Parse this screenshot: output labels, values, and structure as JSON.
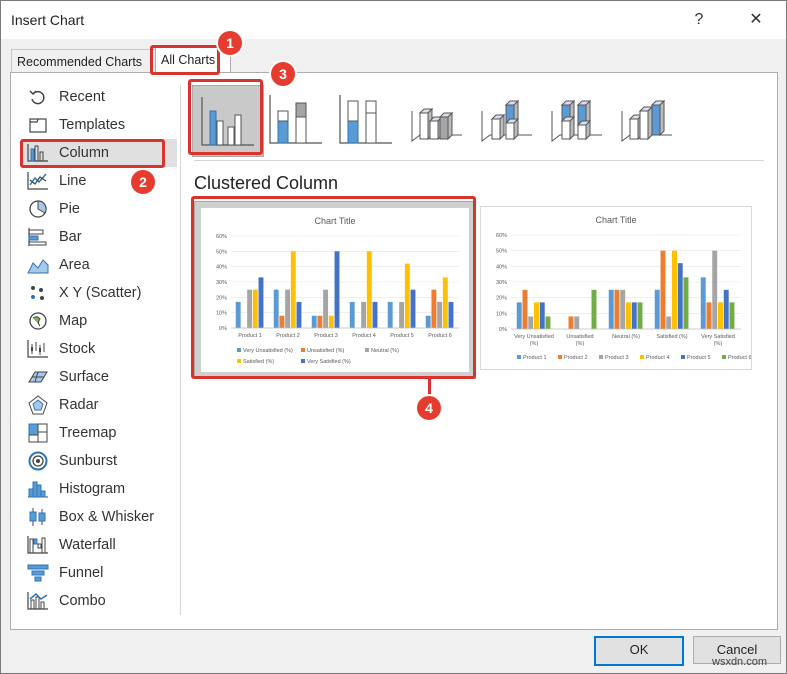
{
  "window": {
    "title": "Insert Chart",
    "help": "?",
    "close": "✕"
  },
  "tabs": [
    {
      "label": "Recommended Charts",
      "active": false
    },
    {
      "label": "All Charts",
      "active": true
    }
  ],
  "chart_types": [
    {
      "label": "Recent",
      "icon": "recent-icon"
    },
    {
      "label": "Templates",
      "icon": "templates-icon"
    },
    {
      "label": "Column",
      "icon": "column-chart-icon",
      "selected": true
    },
    {
      "label": "Line",
      "icon": "line-chart-icon"
    },
    {
      "label": "Pie",
      "icon": "pie-chart-icon"
    },
    {
      "label": "Bar",
      "icon": "bar-chart-icon"
    },
    {
      "label": "Area",
      "icon": "area-chart-icon"
    },
    {
      "label": "X Y (Scatter)",
      "icon": "scatter-chart-icon"
    },
    {
      "label": "Map",
      "icon": "map-chart-icon"
    },
    {
      "label": "Stock",
      "icon": "stock-chart-icon"
    },
    {
      "label": "Surface",
      "icon": "surface-chart-icon"
    },
    {
      "label": "Radar",
      "icon": "radar-chart-icon"
    },
    {
      "label": "Treemap",
      "icon": "treemap-chart-icon"
    },
    {
      "label": "Sunburst",
      "icon": "sunburst-chart-icon"
    },
    {
      "label": "Histogram",
      "icon": "histogram-chart-icon"
    },
    {
      "label": "Box & Whisker",
      "icon": "box-whisker-chart-icon"
    },
    {
      "label": "Waterfall",
      "icon": "waterfall-chart-icon"
    },
    {
      "label": "Funnel",
      "icon": "funnel-chart-icon"
    },
    {
      "label": "Combo",
      "icon": "combo-chart-icon"
    }
  ],
  "subtypes": [
    {
      "icon": "clustered-column-icon",
      "selected": true
    },
    {
      "icon": "stacked-column-icon"
    },
    {
      "icon": "100-stacked-column-icon"
    },
    {
      "icon": "3d-clustered-column-icon"
    },
    {
      "icon": "3d-stacked-column-icon"
    },
    {
      "icon": "3d-100-stacked-column-icon"
    },
    {
      "icon": "3d-column-icon"
    }
  ],
  "subtype_title": "Clustered Column",
  "buttons": {
    "ok": "OK",
    "cancel": "Cancel"
  },
  "badges": [
    "1",
    "2",
    "3",
    "4"
  ],
  "watermark": "wsxdn.com",
  "colors": {
    "blue": "#5b9bd5",
    "orange": "#ed7d31",
    "gray": "#a5a5a5",
    "yellow": "#ffc000",
    "darkblue": "#4472c4",
    "green": "#70ad47",
    "annotation": "#d9342b"
  },
  "chart_data": [
    {
      "type": "bar",
      "title": "Chart Title",
      "categories": [
        "Product 1",
        "Product 2",
        "Product 3",
        "Product 4",
        "Product 5",
        "Product 6"
      ],
      "ylim": [
        0,
        0.6
      ],
      "yticks": [
        "0%",
        "10%",
        "20%",
        "30%",
        "40%",
        "50%",
        "60%"
      ],
      "series": [
        {
          "name": "Very Unsatisfied (%)",
          "values": [
            0.17,
            0.25,
            0.08,
            0.17,
            0.17,
            0.08
          ]
        },
        {
          "name": "Unsatisfied (%)",
          "values": [
            0.0,
            0.08,
            0.08,
            0.0,
            0.0,
            0.25
          ]
        },
        {
          "name": "Neutral (%)",
          "values": [
            0.25,
            0.25,
            0.25,
            0.17,
            0.17,
            0.17
          ]
        },
        {
          "name": "Satisfied (%)",
          "values": [
            0.25,
            0.5,
            0.08,
            0.5,
            0.42,
            0.33
          ]
        },
        {
          "name": "Very Satisfied (%)",
          "values": [
            0.33,
            0.17,
            0.5,
            0.17,
            0.25,
            0.17
          ]
        }
      ],
      "legend": "bottom",
      "selected": true
    },
    {
      "type": "bar",
      "title": "Chart Title",
      "categories": [
        "Very Unsatisfied (%)",
        "Unsatisfied (%)",
        "Neutral (%)",
        "Satisfied (%)",
        "Very Satisfied (%)"
      ],
      "ylim": [
        0,
        0.6
      ],
      "yticks": [
        "0%",
        "10%",
        "20%",
        "30%",
        "40%",
        "50%",
        "60%"
      ],
      "series": [
        {
          "name": "Product 1",
          "values": [
            0.17,
            0.0,
            0.25,
            0.25,
            0.33
          ]
        },
        {
          "name": "Product 2",
          "values": [
            0.25,
            0.08,
            0.25,
            0.5,
            0.17
          ]
        },
        {
          "name": "Product 3",
          "values": [
            0.08,
            0.08,
            0.25,
            0.08,
            0.5
          ]
        },
        {
          "name": "Product 4",
          "values": [
            0.17,
            0.0,
            0.17,
            0.5,
            0.17
          ]
        },
        {
          "name": "Product 5",
          "values": [
            0.17,
            0.0,
            0.17,
            0.42,
            0.25
          ]
        },
        {
          "name": "Product 6",
          "values": [
            0.08,
            0.25,
            0.17,
            0.33,
            0.17
          ]
        }
      ],
      "legend": "bottom",
      "selected": false
    }
  ]
}
